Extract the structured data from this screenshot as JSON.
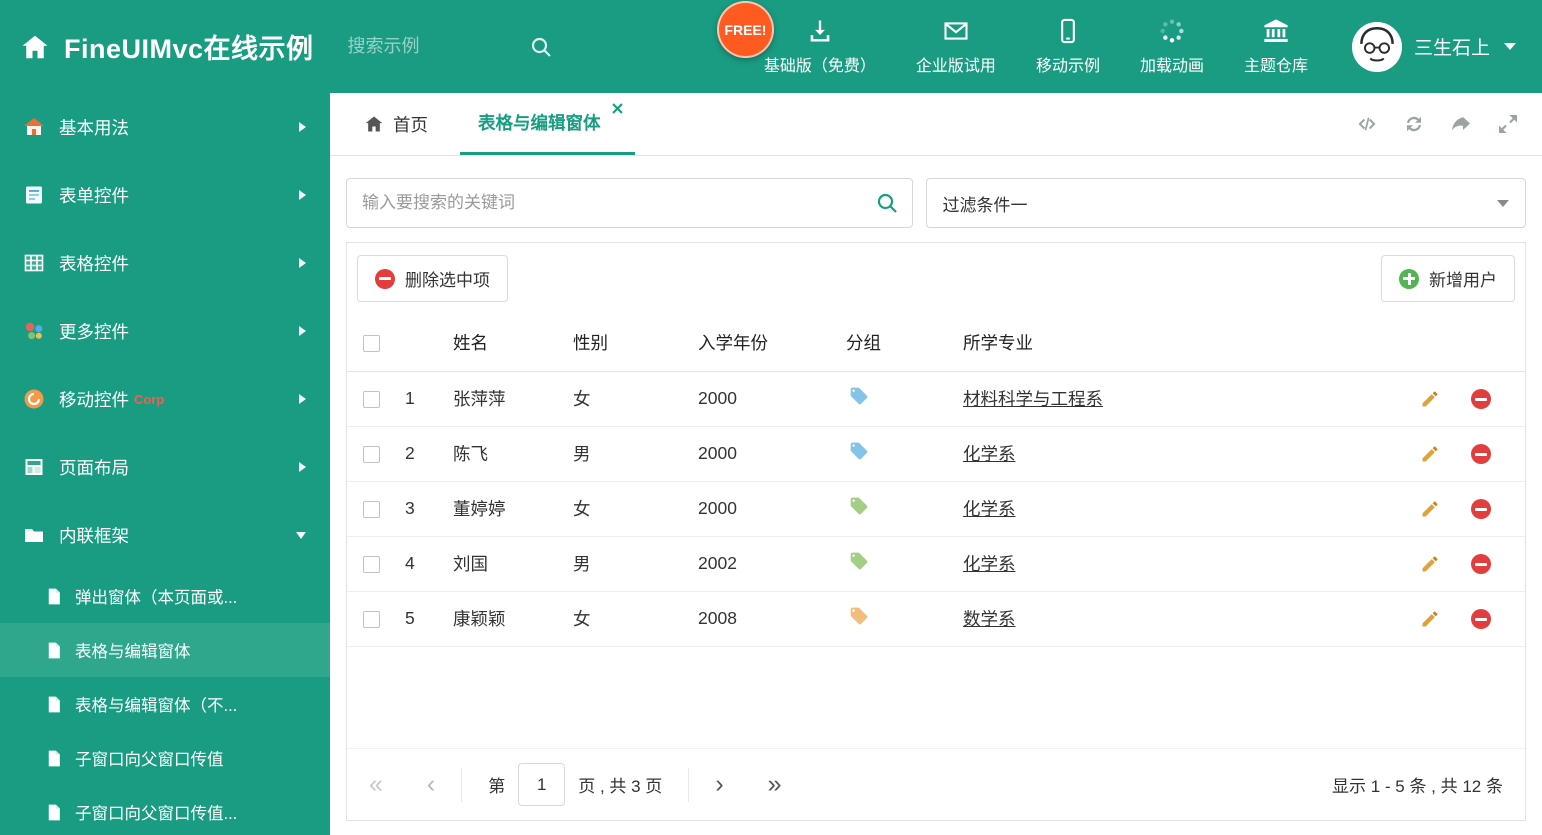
{
  "header": {
    "title": "FineUIMvc在线示例",
    "search": {
      "placeholder": "搜索示例"
    },
    "free_badge": "FREE!",
    "nav": [
      {
        "label": "基础版（免费）"
      },
      {
        "label": "企业版试用"
      },
      {
        "label": "移动示例"
      },
      {
        "label": "加载动画"
      },
      {
        "label": "主题仓库"
      }
    ],
    "user": {
      "name": "三生石上"
    }
  },
  "sidebar": {
    "items": [
      {
        "label": "基本用法"
      },
      {
        "label": "表单控件"
      },
      {
        "label": "表格控件"
      },
      {
        "label": "更多控件"
      },
      {
        "label": "移动控件",
        "badge": "Corp"
      },
      {
        "label": "页面布局"
      },
      {
        "label": "内联框架"
      }
    ],
    "subitems": [
      {
        "label": "弹出窗体（本页面或..."
      },
      {
        "label": "表格与编辑窗体"
      },
      {
        "label": "表格与编辑窗体（不..."
      },
      {
        "label": "子窗口向父窗口传值"
      },
      {
        "label": "子窗口向父窗口传值..."
      }
    ]
  },
  "tabs": {
    "home": {
      "label": "首页"
    },
    "active": {
      "label": "表格与编辑窗体"
    }
  },
  "filter": {
    "search_placeholder": "输入要搜索的关键词",
    "dropdown_value": "过滤条件一"
  },
  "grid": {
    "delete_button": "删除选中项",
    "add_button": "新增用户",
    "columns": {
      "name": "姓名",
      "gender": "性别",
      "year": "入学年份",
      "group": "分组",
      "major": "所学专业"
    },
    "rows": [
      {
        "index": "1",
        "name": "张萍萍",
        "gender": "女",
        "year": "2000",
        "tag_color": "#85C4E8",
        "major": "材料科学与工程系"
      },
      {
        "index": "2",
        "name": "陈飞",
        "gender": "男",
        "year": "2000",
        "tag_color": "#85C4E8",
        "major": "化学系"
      },
      {
        "index": "3",
        "name": "董婷婷",
        "gender": "女",
        "year": "2000",
        "tag_color": "#A3CE85",
        "major": "化学系"
      },
      {
        "index": "4",
        "name": "刘国",
        "gender": "男",
        "year": "2002",
        "tag_color": "#A3CE85",
        "major": "化学系"
      },
      {
        "index": "5",
        "name": "康颖颖",
        "gender": "女",
        "year": "2008",
        "tag_color": "#F2BD7C",
        "major": "数学系"
      }
    ]
  },
  "pagination": {
    "first_glyph": "«",
    "prev_glyph": "‹",
    "next_glyph": "›",
    "last_glyph": "»",
    "page_label_prefix": "第",
    "current_page": "1",
    "page_label_suffix": "页 , 共 3 页",
    "summary": "显示 1 - 5 条 , 共 12 条"
  },
  "colors": {
    "theme": "#1A9C82",
    "sidebar_selected": "#2FA78D",
    "delete_red": "#E23E3E",
    "add_green": "#53B552",
    "pencil_gold": "#DFA23B",
    "free_badge_bg": "#FF5A1F"
  }
}
